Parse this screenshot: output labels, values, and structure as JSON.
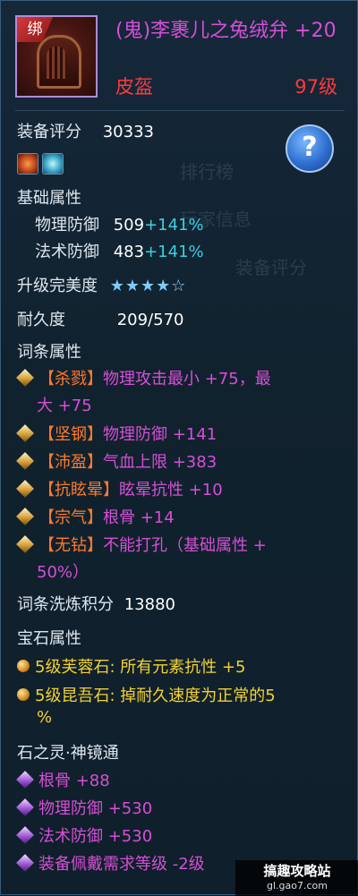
{
  "item": {
    "bind_tag": "绑",
    "name": "(鬼)李裹儿之兔绒弁 +20",
    "category": "皮盔",
    "level": "97级"
  },
  "score": {
    "label": "装备评分",
    "value": "30333"
  },
  "help_label": "?",
  "base": {
    "title": "基础属性",
    "stats": [
      {
        "label": "物理防御",
        "value": "509",
        "bonus": "+141%"
      },
      {
        "label": "法术防御",
        "value": "483",
        "bonus": "+141%"
      }
    ]
  },
  "perfection": {
    "label": "升级完美度",
    "stars_full": "★★★★",
    "stars_empty": "☆",
    "rating": 4,
    "max": 5
  },
  "durability": {
    "label": "耐久度",
    "value": "209/570"
  },
  "affixes": {
    "title": "词条属性",
    "items": [
      {
        "tag": "【杀戮】",
        "text": "物理攻击最小 +75，最",
        "cont": "大 +75"
      },
      {
        "tag": "【坚钢】",
        "text": "物理防御 +141"
      },
      {
        "tag": "【沛盈】",
        "text": "气血上限 +383"
      },
      {
        "tag": "【抗眩晕】",
        "text": "眩晕抗性 +10"
      },
      {
        "tag": "【宗气】",
        "text": "根骨 +14"
      },
      {
        "tag": "【无钻】",
        "text": "不能打孔（基础属性 +",
        "cont": "50%）"
      }
    ]
  },
  "refine": {
    "label": "词条洗炼积分",
    "value": "13880"
  },
  "gems": {
    "title": "宝石属性",
    "items": [
      {
        "text": "5级芙蓉石: 所有元素抗性 +5"
      },
      {
        "text": "5级昆吾石: 掉耐久速度为正常的5",
        "cont": "%"
      }
    ]
  },
  "spirit": {
    "title": "石之灵·神镜通",
    "items": [
      {
        "text": "根骨 +88"
      },
      {
        "text": "物理防御 +530"
      },
      {
        "text": "法术防御 +530"
      },
      {
        "text": "装备佩戴需求等级 -2级"
      }
    ]
  },
  "watermark": {
    "line1": "搞趣攻略站",
    "line2": "gl.gao7.com"
  }
}
